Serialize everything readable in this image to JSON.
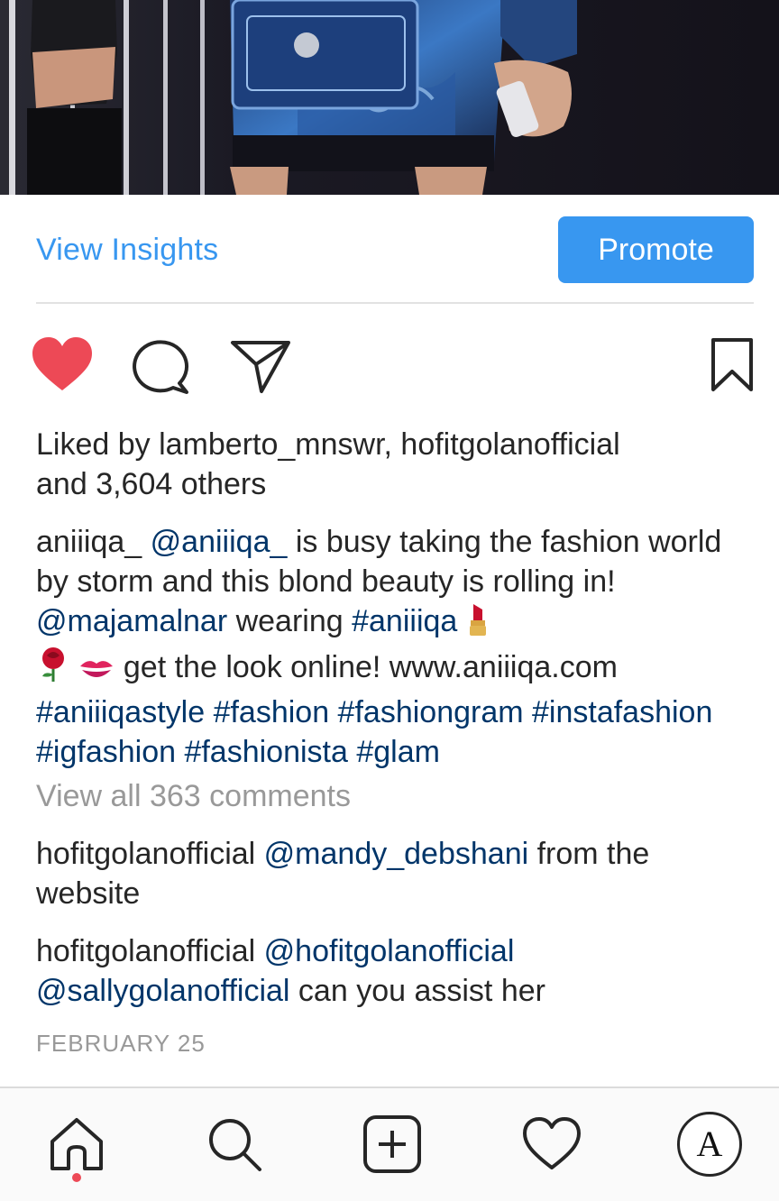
{
  "post": {
    "view_insights": "View Insights",
    "promote": "Promote",
    "likes": {
      "prefix": "Liked by ",
      "user1": "lamberto_mnswr",
      "separator": ", ",
      "user2": "hofitgolanofficial",
      "and": " and ",
      "others": "3,604 others"
    },
    "caption": {
      "username": "aniiiqa_",
      "mention1": "@aniiiqa_",
      "text1": " is busy taking the fashion world by storm and this blond beauty is rolling in!  ",
      "mention2": "@majamalnar",
      "text2": " wearing ",
      "tag1": "#aniiiqa",
      "emoji1": "lipstick-emoji",
      "emoji2": "rose-emoji",
      "emoji3": "kiss-mark-emoji",
      "text3": " get the look online! www.aniiiqa.com ",
      "tags": "#aniiiqastyle #fashion #fashiongram #instafashion #igfashion #fashionista #glam"
    },
    "view_all_comments": "View all 363 comments",
    "comments": [
      {
        "username": "hofitgolanofficial",
        "mention": "@mandy_debshani",
        "text": " from the website"
      },
      {
        "username": "hofitgolanofficial",
        "mention": "@hofitgolanofficial",
        "mention2": "@sallygolanofficial",
        "text": " can you assist her"
      }
    ],
    "date": "FEBRUARY 25"
  },
  "icons": {
    "like": "heart-filled-icon",
    "comment": "comment-bubble-icon",
    "share": "paper-plane-icon",
    "save": "bookmark-icon"
  },
  "nav": {
    "items": [
      "home-icon",
      "search-icon",
      "add-post-icon",
      "activity-heart-icon",
      "profile-avatar"
    ],
    "avatar_letter": "A",
    "active": "home"
  },
  "colors": {
    "accent_blue": "#3897f0",
    "link_navy": "#003569",
    "like_red": "#ed4956",
    "muted_gray": "#999999"
  }
}
